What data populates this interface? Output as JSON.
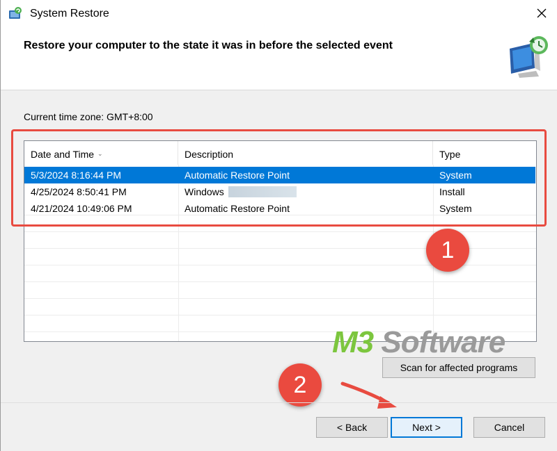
{
  "window": {
    "title": "System Restore",
    "headline": "Restore your computer to the state it was in before the selected event",
    "app_icon": "system-restore-icon",
    "hero_icon": "restore-monitor-icon",
    "close_icon": "close-icon"
  },
  "timezone_label": "Current time zone: GMT+8:00",
  "table": {
    "columns": [
      "Date and Time",
      "Description",
      "Type"
    ],
    "sorted_column": "Date and Time",
    "rows": [
      {
        "date": "5/3/2024 8:16:44 PM",
        "description": "Automatic Restore Point",
        "type": "System",
        "selected": true
      },
      {
        "date": "4/25/2024 8:50:41 PM",
        "description": "Windows ",
        "type": "Install",
        "selected": false
      },
      {
        "date": "4/21/2024 10:49:06 PM",
        "description": "Automatic Restore Point",
        "type": "System",
        "selected": false
      }
    ]
  },
  "annotations": {
    "step1": "1",
    "step2": "2",
    "highlight_color": "#e84b40"
  },
  "watermark": {
    "prefix": "M3",
    "suffix": " Software",
    "prefix_color": "#7cc63e",
    "suffix_color": "#9a9a9a"
  },
  "buttons": {
    "scan": "Scan for affected programs",
    "back": "< Back",
    "next": "Next >",
    "cancel": "Cancel"
  },
  "colors": {
    "selection": "#0078d7",
    "accent": "#0078d7"
  }
}
